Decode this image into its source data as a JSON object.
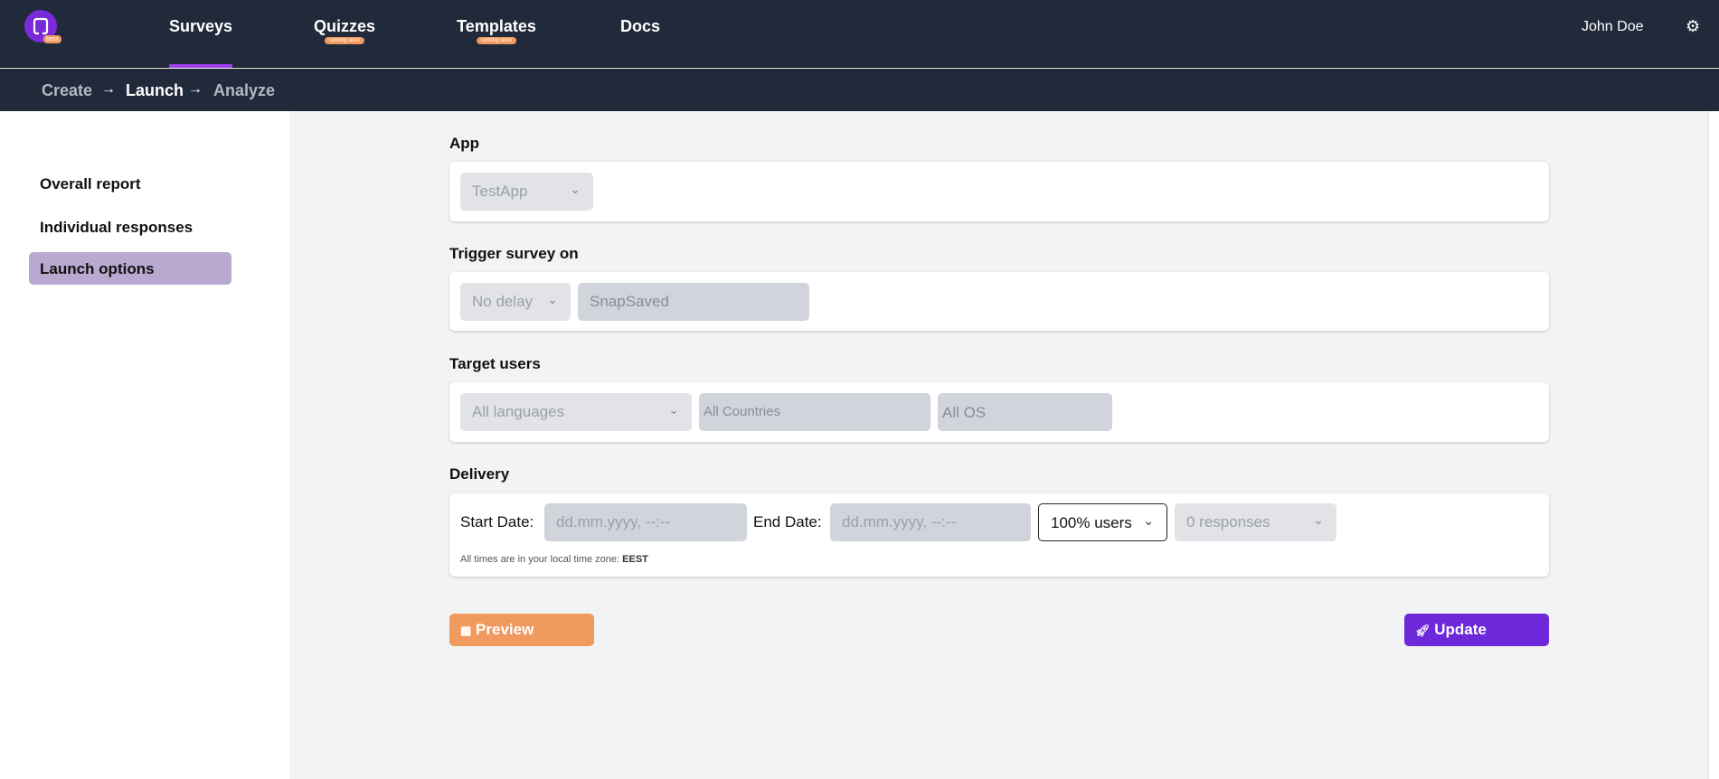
{
  "nav": {
    "logo_badge": "beta",
    "items": [
      {
        "label": "Surveys",
        "badge": ""
      },
      {
        "label": "Quizzes",
        "badge": "coming soon"
      },
      {
        "label": "Templates",
        "badge": "coming soon"
      },
      {
        "label": "Docs",
        "badge": ""
      }
    ],
    "user": "John Doe",
    "settings_icon": "gear-icon"
  },
  "breadcrumb": [
    "Create",
    "Launch",
    "Analyze"
  ],
  "sidebar": {
    "items": [
      {
        "label": "Overall report"
      },
      {
        "label": "Individual responses"
      },
      {
        "label": "Launch options",
        "active": true
      }
    ]
  },
  "app": {
    "label": "App",
    "value": "TestApp"
  },
  "trigger": {
    "label": "Trigger survey on",
    "delay": "No delay",
    "event": "SnapSaved"
  },
  "target": {
    "label": "Target users",
    "languages": "All languages",
    "countries": "All Countries",
    "os": "All OS"
  },
  "delivery": {
    "label": "Delivery",
    "start_label": "Start Date:",
    "start_placeholder": "dd.mm.yyyy, --:--",
    "end_label": "End Date:",
    "end_placeholder": "dd.mm.yyyy, --:--",
    "users": "100% users",
    "responses": "0 responses",
    "note": "All times are in your local time zone:",
    "timezone": "EEST"
  },
  "actions": {
    "preview": "Preview",
    "update": "Update"
  },
  "colors": {
    "nav_bg": "#212a3a",
    "accent": "#7a2bd9",
    "preview": "#f09a5f",
    "update": "#6d28d9",
    "active_sidebar": "#b9a8d0"
  }
}
